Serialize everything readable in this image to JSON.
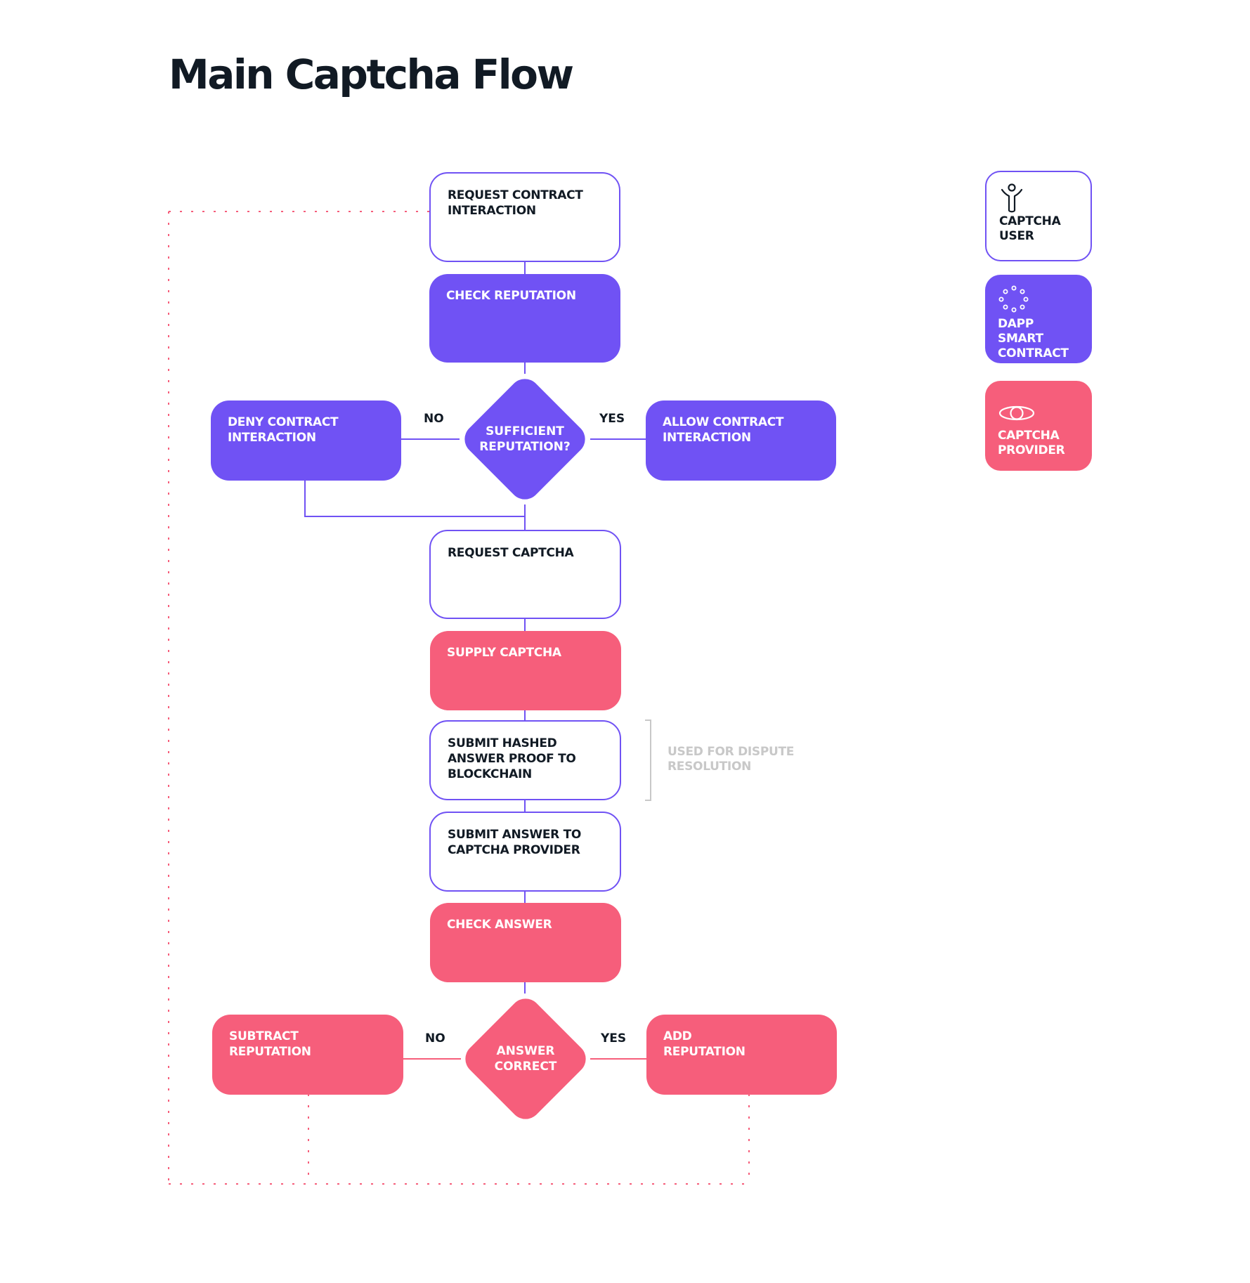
{
  "title": "Main Captcha Flow",
  "colors": {
    "user": "#7052f4",
    "dapp": "#7052f4",
    "provider": "#f65e7b",
    "text_dark": "#111a24",
    "note_gray": "#c8c8c8"
  },
  "nodes": {
    "request_contract": {
      "label": "REQUEST CONTRACT\nINTERACTION",
      "actor": "captcha-user"
    },
    "check_reputation": {
      "label": "CHECK REPUTATION",
      "actor": "dapp-smart-contract"
    },
    "sufficient_reputation": {
      "label": "SUFFICIENT\nREPUTATION?",
      "actor": "dapp-smart-contract",
      "type": "decision"
    },
    "deny_contract": {
      "label": "DENY CONTRACT\nINTERACTION",
      "actor": "dapp-smart-contract"
    },
    "allow_contract": {
      "label": "ALLOW CONTRACT\nINTERACTION",
      "actor": "dapp-smart-contract"
    },
    "request_captcha": {
      "label": "REQUEST CAPTCHA",
      "actor": "captcha-user"
    },
    "supply_captcha": {
      "label": "SUPPLY CAPTCHA",
      "actor": "captcha-provider"
    },
    "submit_hashed": {
      "label": "SUBMIT HASHED\nANSWER PROOF TO\nBLOCKCHAIN",
      "actor": "captcha-user"
    },
    "submit_answer": {
      "label": "SUBMIT ANSWER TO\nCAPTCHA PROVIDER",
      "actor": "captcha-user"
    },
    "check_answer": {
      "label": "CHECK ANSWER",
      "actor": "captcha-provider"
    },
    "answer_correct": {
      "label": "ANSWER\nCORRECT",
      "actor": "captcha-provider",
      "type": "decision"
    },
    "subtract_reputation": {
      "label": "SUBTRACT\nREPUTATION",
      "actor": "captcha-provider"
    },
    "add_reputation": {
      "label": "ADD\nREPUTATION",
      "actor": "captcha-provider"
    }
  },
  "edge_labels": {
    "rep_no": "NO",
    "rep_yes": "YES",
    "ans_no": "NO",
    "ans_yes": "YES"
  },
  "note": "USED FOR DISPUTE\nRESOLUTION",
  "legend": [
    {
      "label": "CAPTCHA\nUSER",
      "icon": "person-icon"
    },
    {
      "label": "DAPP SMART\nCONTRACT",
      "icon": "dots-circle-icon"
    },
    {
      "label": "CAPTCHA\nPROVIDER",
      "icon": "eye-icon"
    }
  ]
}
